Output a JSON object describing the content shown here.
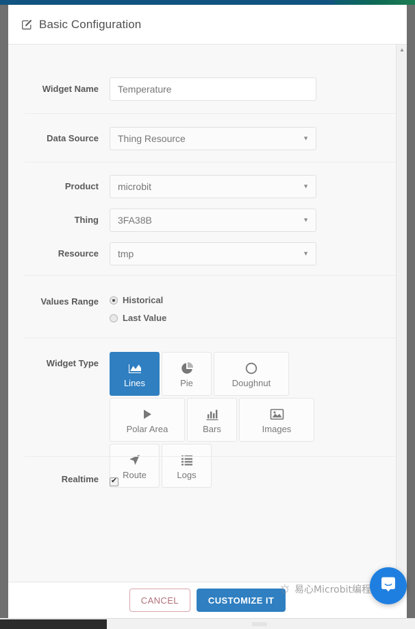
{
  "chrome": {
    "topbar_color": "#12537f",
    "accent_gradient": "#1c7d52"
  },
  "modal": {
    "title": "Basic Configuration",
    "title_icon": "pencil-square-icon"
  },
  "form": {
    "widget_name": {
      "label": "Widget Name",
      "value": "Temperature",
      "placeholder": "Widget Name"
    },
    "data_source": {
      "label": "Data Source",
      "value": "Thing Resource",
      "options": [
        "Thing Resource"
      ]
    },
    "product": {
      "label": "Product",
      "value": "microbit",
      "options": [
        "microbit"
      ]
    },
    "thing": {
      "label": "Thing",
      "value": "3FA38B",
      "options": [
        "3FA38B"
      ]
    },
    "resource": {
      "label": "Resource",
      "value": "tmp",
      "options": [
        "tmp"
      ]
    },
    "values_range": {
      "label": "Values Range",
      "selected": "Historical",
      "options": [
        {
          "label": "Historical",
          "checked": true
        },
        {
          "label": "Last Value",
          "checked": false
        }
      ]
    },
    "widget_type": {
      "label": "Widget Type",
      "selected": "Lines",
      "options": [
        {
          "label": "Lines",
          "icon": "area-chart-icon",
          "selected": true,
          "wide": false
        },
        {
          "label": "Pie",
          "icon": "pie-chart-icon",
          "selected": false,
          "wide": false
        },
        {
          "label": "Doughnut",
          "icon": "circle-outline-icon",
          "selected": false,
          "wide": true
        },
        {
          "label": "Polar Area",
          "icon": "play-triangle-icon",
          "selected": false,
          "wide": true
        },
        {
          "label": "Bars",
          "icon": "bar-chart-icon",
          "selected": false,
          "wide": false
        },
        {
          "label": "Images",
          "icon": "picture-icon",
          "selected": false,
          "wide": true
        },
        {
          "label": "Route",
          "icon": "location-arrow-icon",
          "selected": false,
          "wide": false
        },
        {
          "label": "Logs",
          "icon": "list-icon",
          "selected": false,
          "wide": false
        }
      ]
    },
    "realtime": {
      "label": "Realtime",
      "checked": true,
      "tick": "✔"
    }
  },
  "footer": {
    "cancel_label": "CANCEL",
    "submit_label": "CUSTOMIZE IT"
  },
  "chat": {
    "icon": "chat-bubble-icon",
    "accent": "#1f7fe0"
  },
  "watermark": {
    "text": "易心Microbit编程"
  },
  "scrollbar": {
    "up_arrow": "▲",
    "down_arrow": "▼"
  }
}
